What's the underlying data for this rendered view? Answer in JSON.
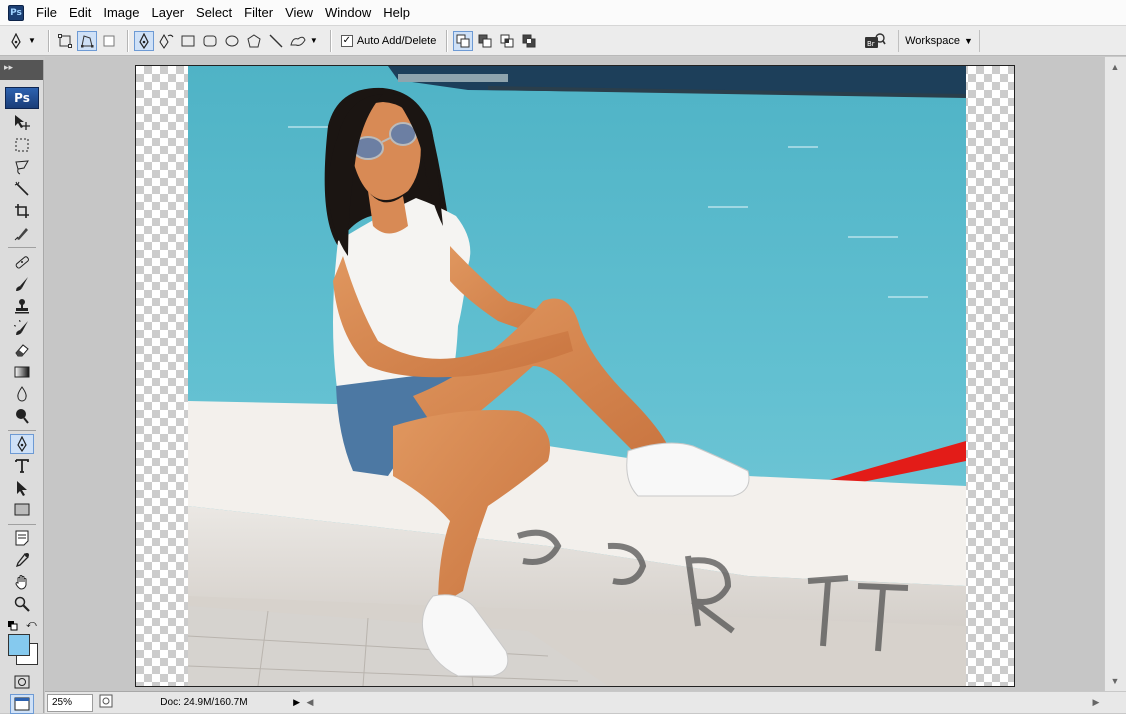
{
  "app": {
    "icon_label": "Ps"
  },
  "menubar": {
    "items": [
      "File",
      "Edit",
      "Image",
      "Layer",
      "Select",
      "Filter",
      "View",
      "Window",
      "Help"
    ]
  },
  "options": {
    "auto_add_delete_label": "Auto Add/Delete",
    "auto_add_delete_checked": "✓",
    "workspace_label": "Workspace"
  },
  "tools": {
    "logo_label": "Ps",
    "header_label": "▸▸"
  },
  "status": {
    "zoom": "25%",
    "doc_info": "Doc: 24.9M/160.7M"
  },
  "colors": {
    "foreground": "#85c9ee",
    "background": "#ffffff",
    "accent": "#6d9ad4"
  }
}
